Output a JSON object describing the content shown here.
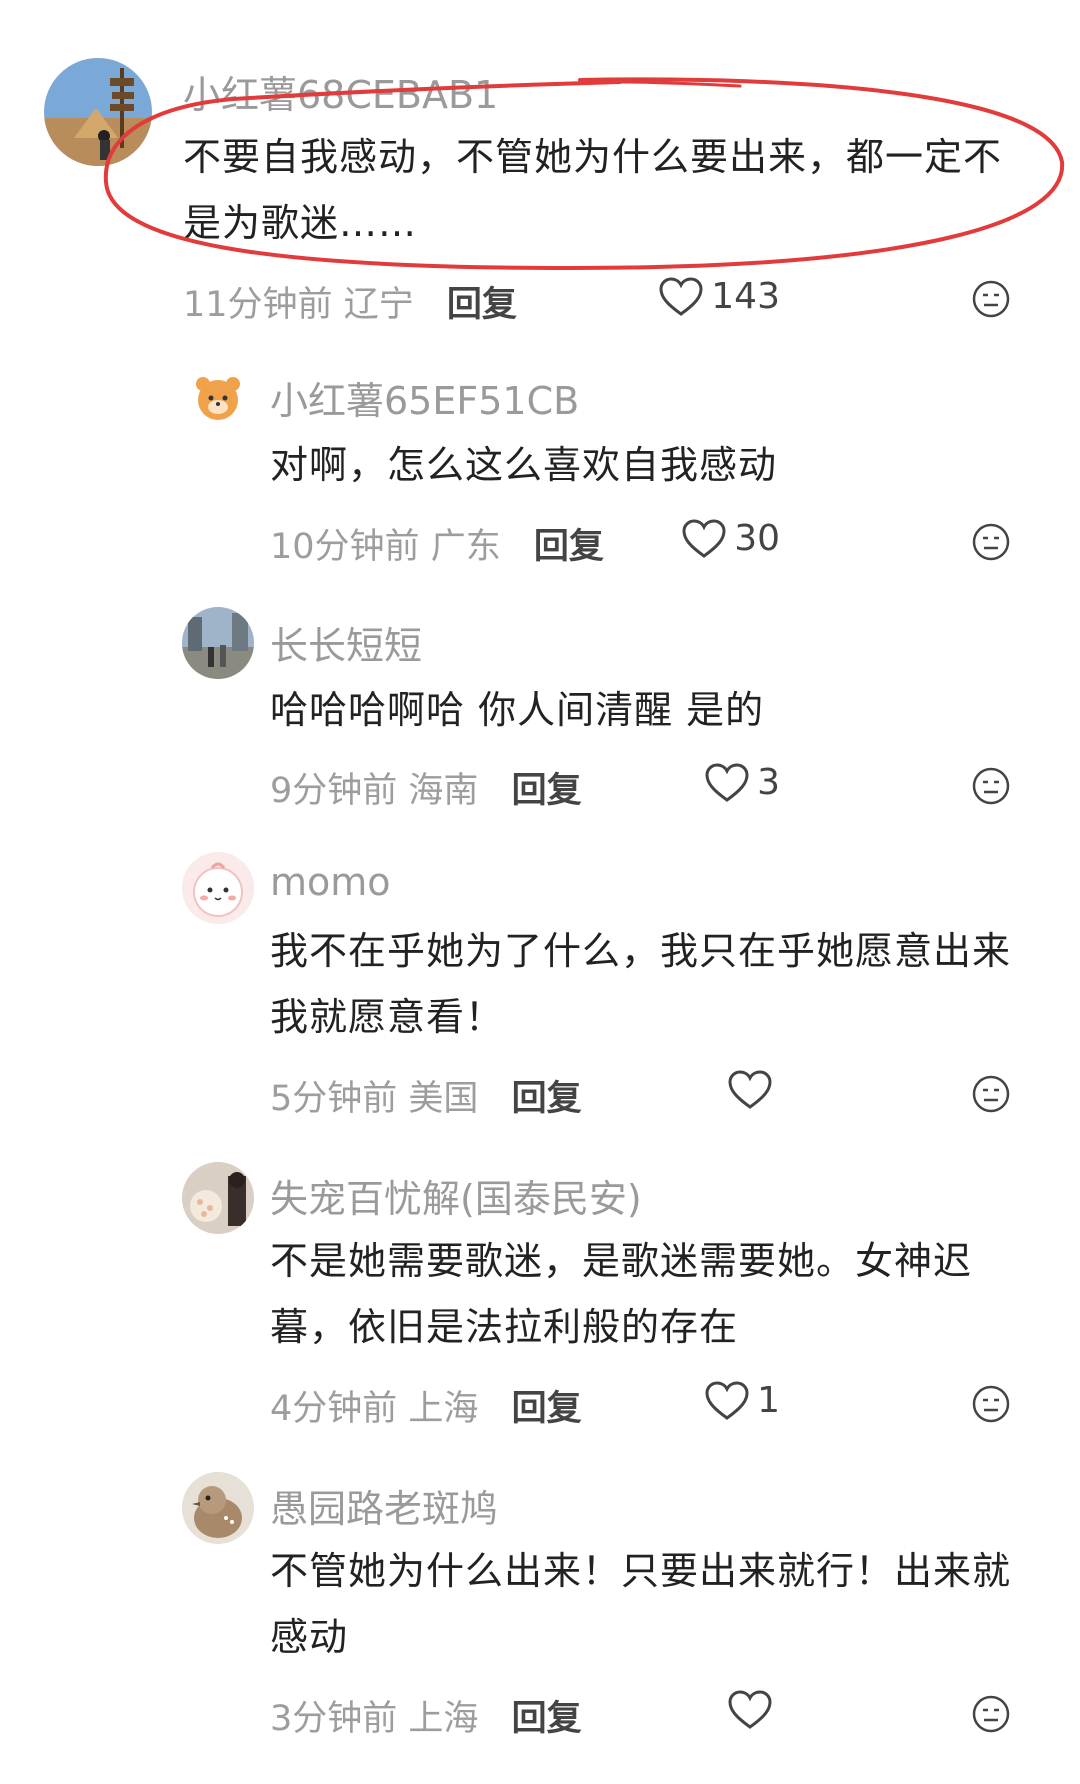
{
  "comments": [
    {
      "user": "小红薯68CEBAB1",
      "text": "不要自我感动，不管她为什么要出来，都一定不是为歌迷……",
      "time": "11分钟前",
      "location": "辽宁",
      "reply": "回复",
      "likes": "143"
    },
    {
      "user": "小红薯65EF51CB",
      "text": "对啊，怎么这么喜欢自我感动",
      "time": "10分钟前",
      "location": "广东",
      "reply": "回复",
      "likes": "30"
    },
    {
      "user": "长长短短",
      "text": "哈哈哈啊哈 你人间清醒 是的",
      "time": "9分钟前",
      "location": "海南",
      "reply": "回复",
      "likes": "3"
    },
    {
      "user": "momo",
      "text": "我不在乎她为了什么，我只在乎她愿意出来我就愿意看！",
      "time": "5分钟前",
      "location": "美国",
      "reply": "回复",
      "likes": ""
    },
    {
      "user": "失宠百忧解(国泰民安)",
      "text": "不是她需要歌迷，是歌迷需要她。女神迟暮，依旧是法拉利般的存在",
      "time": "4分钟前",
      "location": "上海",
      "reply": "回复",
      "likes": "1"
    },
    {
      "user": "愚园路老斑鸠",
      "text": "不管她为什么出来！只要出来就行！出来就感动",
      "time": "3分钟前",
      "location": "上海",
      "reply": "回复",
      "likes": ""
    }
  ],
  "icons": {
    "like": "heart-outline-icon",
    "dislike": "meh-face-icon"
  },
  "colors": {
    "highlight": "#e23b3b",
    "meta": "#9d9d9d",
    "name": "#9a9a9a"
  }
}
